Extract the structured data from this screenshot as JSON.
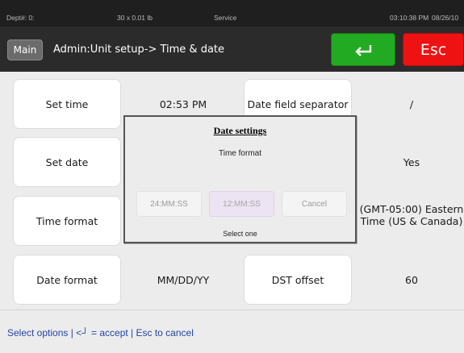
{
  "status_bar": {
    "dept": "Dept#: 0:",
    "scale": "30 x 0.01 lb",
    "mode": "Service",
    "time": "03:10:38 PM",
    "date": "08/26/10"
  },
  "title_bar": {
    "main_label": "Main",
    "breadcrumb": "Admin:Unit setup-> Time & date",
    "esc_label": "Esc",
    "enter_icon": "enter-arrow-icon",
    "enter_color": "#22aa22",
    "esc_color": "#ee1212"
  },
  "settings": {
    "set_time": {
      "label": "Set time",
      "value": "02:53 PM"
    },
    "set_date": {
      "label": "Set date"
    },
    "time_format": {
      "label": "Time format"
    },
    "date_format": {
      "label": "Date format",
      "value": "MM/DD/YY"
    },
    "date_field_separator": {
      "label": "Date field separator",
      "value": "/"
    },
    "yes_value": "Yes",
    "time_zone_value": "(GMT-05:00) Eastern Time (US & Canada)",
    "dst_offset": {
      "label": "DST offset",
      "value": "60"
    }
  },
  "dialog": {
    "title": "Date settings",
    "subtitle": "Time format",
    "options": [
      "24:MM:SS",
      "12:MM:SS",
      "Cancel"
    ],
    "selected_option": "12:MM:SS",
    "footer": "Select one"
  },
  "footer": {
    "hint": "Select options | <┘ = accept | Esc to cancel"
  }
}
